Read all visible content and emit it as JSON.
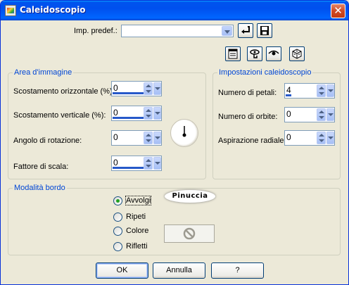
{
  "window": {
    "title": "Caleidoscopio",
    "close_glyph": "✕"
  },
  "presets": {
    "label": "Imp. predef.:",
    "value": ""
  },
  "toolbar": {
    "icons": [
      "reset-icon",
      "save-icon",
      "dialog-icon",
      "hand-icon",
      "eye-icon",
      "dice-icon"
    ]
  },
  "image_area": {
    "title": "Area d'immagine",
    "fields": [
      {
        "label": "Scostamento orizzontale (%):",
        "value": "0"
      },
      {
        "label": "Scostamento verticale (%):",
        "value": "0"
      },
      {
        "label": "Angolo di rotazione:",
        "value": "0"
      },
      {
        "label": "Fattore di scala:",
        "value": "0"
      }
    ]
  },
  "kaleido": {
    "title": "Impostazioni caleidoscopio",
    "fields": [
      {
        "label": "Numero di petali:",
        "value": "4"
      },
      {
        "label": "Numero di orbite:",
        "value": "0"
      },
      {
        "label": "Aspirazione radiale:",
        "value": "0"
      }
    ]
  },
  "border_mode": {
    "title": "Modalità bordo",
    "options": [
      {
        "label": "Avvolgi",
        "selected": true
      },
      {
        "label": "Ripeti",
        "selected": false
      },
      {
        "label": "Colore",
        "selected": false
      },
      {
        "label": "Rifletti",
        "selected": false
      }
    ],
    "watermark": "Pinuccia"
  },
  "buttons": {
    "ok": "OK",
    "cancel": "Annulla",
    "help": "?"
  }
}
